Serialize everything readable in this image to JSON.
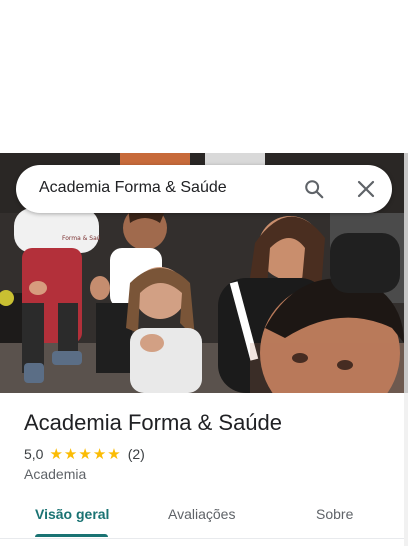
{
  "search": {
    "query": "Academia Forma & Saúde"
  },
  "place": {
    "name": "Academia Forma & Saúde",
    "rating": "5,0",
    "stars": 5,
    "review_count": "(2)",
    "category": "Academia"
  },
  "tabs": [
    {
      "label": "Visão geral",
      "active": true
    },
    {
      "label": "Avaliações",
      "active": false
    },
    {
      "label": "Sobre",
      "active": false
    }
  ],
  "colors": {
    "accent": "#1a7373",
    "star": "#fbbc04"
  },
  "photo": {
    "shirt_text": "Forma & Saú"
  }
}
